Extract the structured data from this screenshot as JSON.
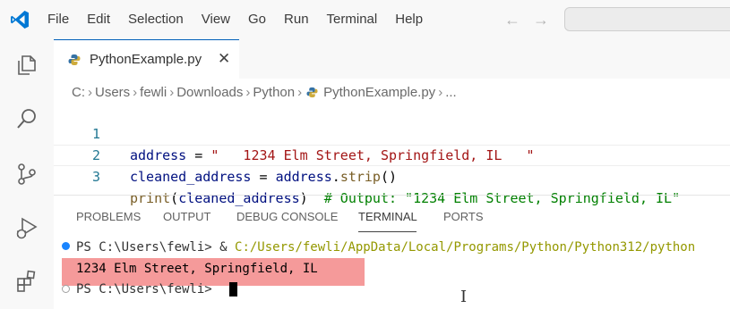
{
  "menu": [
    "File",
    "Edit",
    "Selection",
    "View",
    "Go",
    "Run",
    "Terminal",
    "Help"
  ],
  "nav": {
    "back": "←",
    "forward": "→"
  },
  "tab": {
    "label": "PythonExample.py",
    "close": "✕"
  },
  "breadcrumb": {
    "parts": [
      "C:",
      "Users",
      "fewli",
      "Downloads",
      "Python",
      "PythonExample.py",
      "..."
    ],
    "sep": "›"
  },
  "code": {
    "line_numbers": [
      "1",
      "2",
      "3"
    ],
    "l1": {
      "var": "address",
      "eq": " = ",
      "str": "\"   1234 Elm Street, Springfield, IL   \""
    },
    "l2": {
      "var": "cleaned_address",
      "eq": " = ",
      "obj": "address",
      "dot": ".",
      "method": "strip",
      "paren": "()"
    },
    "l3": {
      "fn": "print",
      "open": "(",
      "arg": "cleaned_address",
      "close": ")",
      "comment": "  # Output: \"1234 Elm Street, Springfield, IL\""
    }
  },
  "panel": {
    "tabs": [
      "PROBLEMS",
      "OUTPUT",
      "DEBUG CONSOLE",
      "TERMINAL",
      "PORTS"
    ],
    "active": "TERMINAL"
  },
  "terminal": {
    "prompt1": "PS C:\\Users\\fewli> & ",
    "path1": "C:/Users/fewli/AppData/Local/Programs/Python/Python312/python",
    "output": "1234 Elm Street, Springfield, IL",
    "prompt2": "PS C:\\Users\\fewli> "
  },
  "colors": {
    "accent": "#005fb8",
    "output_highlight": "#f59a9a",
    "success_dot": "#1a85ff"
  },
  "icons": [
    "vscode-logo-icon",
    "explorer-icon",
    "search-icon",
    "source-control-icon",
    "run-debug-icon",
    "extensions-icon",
    "python-file-icon",
    "close-icon"
  ]
}
